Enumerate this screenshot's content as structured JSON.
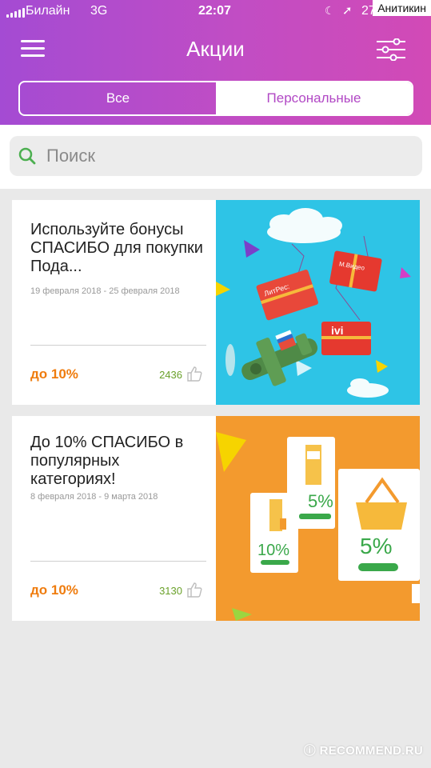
{
  "status_bar": {
    "carrier": "Билайн",
    "network": "3G",
    "time": "22:07",
    "battery_text": "27%",
    "watermark_user": "Анитикин"
  },
  "header": {
    "title": "Акции",
    "menu_icon": "hamburger-menu-icon",
    "filter_icon": "sliders-filter-icon",
    "tabs": [
      {
        "label": "Все",
        "active": true
      },
      {
        "label": "Персональные",
        "active": false
      }
    ],
    "gradient_colors": [
      "#a44bd3",
      "#d24ab6"
    ]
  },
  "search": {
    "placeholder": "Поиск",
    "icon": "search-icon",
    "icon_color": "#4caf50"
  },
  "offers": [
    {
      "title": "Используйте бонусы СПАСИБО для покупки Пода...",
      "dates": "19 февраля 2018 - 25 февраля 2018",
      "discount": "до 10%",
      "likes": "2436",
      "image_tags": [
        "ЛитРес:",
        "М.Видео",
        "ivi"
      ]
    },
    {
      "title": "До 10% СПАСИБО в популярных категориях!",
      "dates": "8 февраля 2018 - 9 марта 2018",
      "discount": "до 10%",
      "likes": "3130",
      "image_tags": [
        "10%",
        "5%",
        "5%"
      ]
    }
  ],
  "footer_watermark": "RECOMMEND.RU",
  "colors": {
    "discount": "#ef7c0e",
    "likes": "#6aa12a",
    "tab_inactive_text": "#b148c5"
  }
}
